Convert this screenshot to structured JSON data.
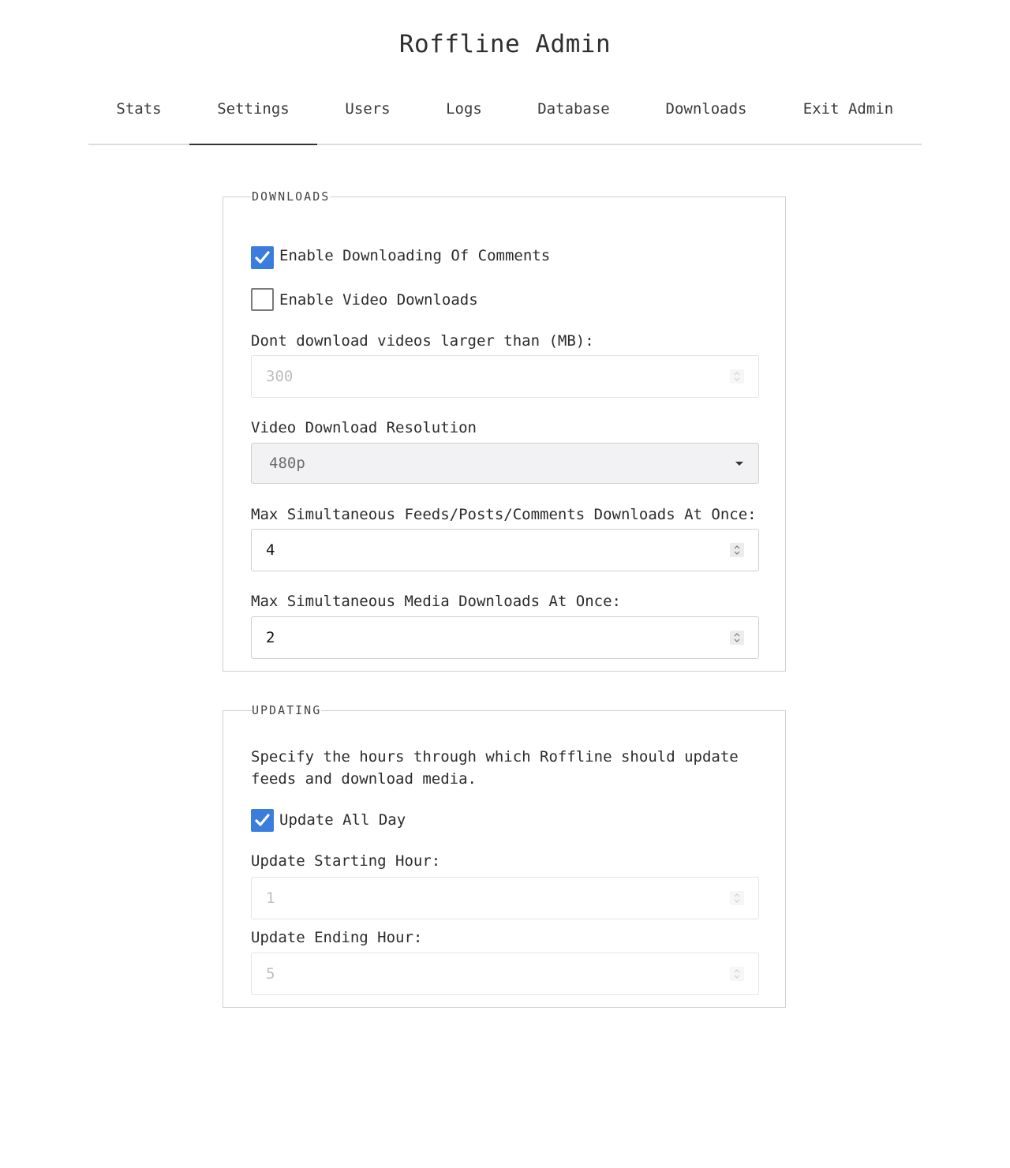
{
  "app": {
    "title": "Roffline Admin"
  },
  "nav": {
    "tabs": [
      {
        "label": "Stats",
        "active": false
      },
      {
        "label": "Settings",
        "active": true
      },
      {
        "label": "Users",
        "active": false
      },
      {
        "label": "Logs",
        "active": false
      },
      {
        "label": "Database",
        "active": false
      },
      {
        "label": "Downloads",
        "active": false
      },
      {
        "label": "Exit Admin",
        "active": false
      }
    ]
  },
  "downloads_section": {
    "legend": "DOWNLOADS",
    "enable_comments": {
      "label": "Enable Downloading Of Comments",
      "checked": true
    },
    "enable_video": {
      "label": "Enable Video Downloads",
      "checked": false
    },
    "max_video_size": {
      "label": "Dont download videos larger than (MB):",
      "value": "300",
      "disabled": true
    },
    "video_resolution": {
      "label": "Video Download Resolution",
      "value": "480p"
    },
    "max_feed_downloads": {
      "label": "Max Simultaneous Feeds/Posts/Comments Downloads At Once:",
      "value": "4"
    },
    "max_media_downloads": {
      "label": "Max Simultaneous Media Downloads At Once:",
      "value": "2"
    }
  },
  "updating_section": {
    "legend": "UPDATING",
    "description": "Specify the hours through which Roffline should update feeds and download media.",
    "update_all_day": {
      "label": "Update All Day",
      "checked": true
    },
    "start_hour": {
      "label": "Update Starting Hour:",
      "value": "1",
      "disabled": true
    },
    "end_hour": {
      "label": "Update Ending Hour:",
      "value": "5",
      "disabled": true
    }
  },
  "colors": {
    "accent": "#3b7ddd",
    "text": "#2b2b2b",
    "border": "#d0d0d0",
    "disabled_text": "#bdbdbd"
  }
}
